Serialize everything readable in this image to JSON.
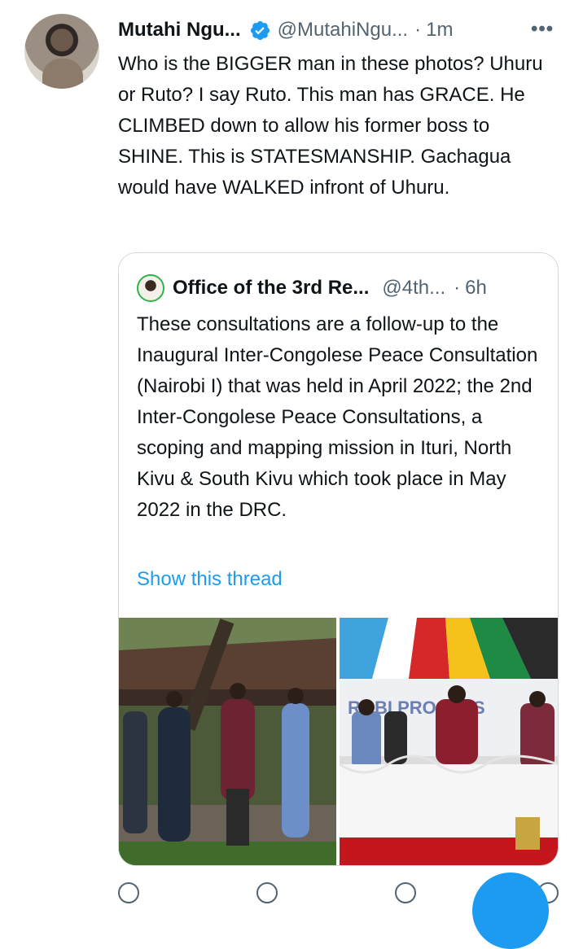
{
  "author": {
    "name": "Mutahi Ngu...",
    "handle": "@MutahiNgu...",
    "separator": "·",
    "time": "1m"
  },
  "more_label": "•••",
  "tweet_text": "Who is the BIGGER man in these photos? Uhuru or Ruto? I say Ruto. This man has GRACE. He CLIMBED down to allow his former boss to SHINE. This is STATESMANSHIP. Gachagua would have WALKED infront of Uhuru.",
  "quoted": {
    "name": "Office of the 3rd Re...",
    "handle": "@4th...",
    "separator": "·",
    "time": "6h",
    "text": "These consultations are a follow-up to the Inaugural Inter-Congolese Peace Consultation (Nairobi I) that was held in April 2022; the 2nd Inter-Congolese Peace Consultations, a scoping and mapping mission in Ituri, North Kivu & South Kivu which took place in May 2022 in the DRC.",
    "thread_link": "Show this thread",
    "photo_right_banner": "ROBI PROCESS"
  },
  "colors": {
    "accent": "#1d9bf0",
    "text": "#0f1419",
    "secondary": "#536471",
    "border": "#cfd9de"
  },
  "icons": [
    "verified-badge-icon",
    "more-options-icon",
    "reply-icon",
    "retweet-icon",
    "like-icon",
    "share-icon",
    "compose-icon"
  ]
}
